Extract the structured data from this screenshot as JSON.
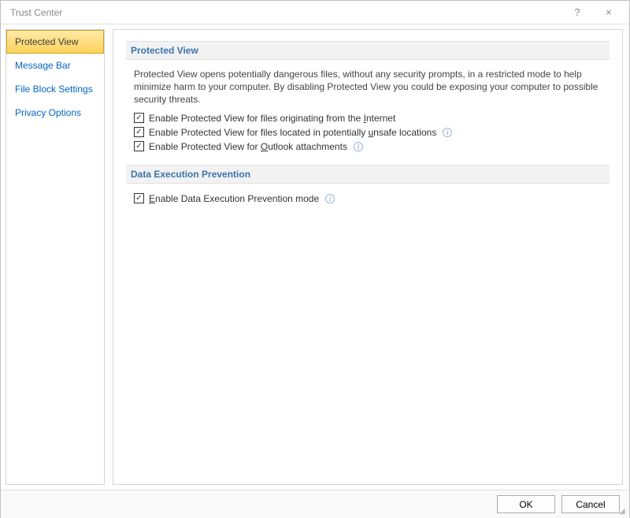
{
  "window": {
    "title": "Trust Center",
    "help_tooltip": "?",
    "close_tooltip": "×"
  },
  "sidebar": {
    "items": [
      {
        "label": "Protected View",
        "selected": true
      },
      {
        "label": "Message Bar",
        "selected": false
      },
      {
        "label": "File Block Settings",
        "selected": false
      },
      {
        "label": "Privacy Options",
        "selected": false
      }
    ]
  },
  "sections": {
    "protected_view": {
      "header": "Protected View",
      "description": "Protected View opens potentially dangerous files, without any security prompts, in a restricted mode to help minimize harm to your computer. By disabling Protected View you could be exposing your computer to possible security threats.",
      "options": [
        {
          "label_pre": "Enable Protected View for files originating from the ",
          "label_u": "I",
          "label_post": "nternet",
          "checked": true,
          "info": false
        },
        {
          "label_pre": "Enable Protected View for files located in potentially ",
          "label_u": "u",
          "label_post": "nsafe locations",
          "checked": true,
          "info": true
        },
        {
          "label_pre": "Enable Protected View for ",
          "label_u": "O",
          "label_post": "utlook attachments",
          "checked": true,
          "info": true
        }
      ]
    },
    "dep": {
      "header": "Data Execution Prevention",
      "options": [
        {
          "label_pre": "",
          "label_u": "E",
          "label_post": "nable Data Execution Prevention mode",
          "checked": true,
          "info": true
        }
      ]
    }
  },
  "footer": {
    "ok_label": "OK",
    "cancel_label": "Cancel"
  }
}
